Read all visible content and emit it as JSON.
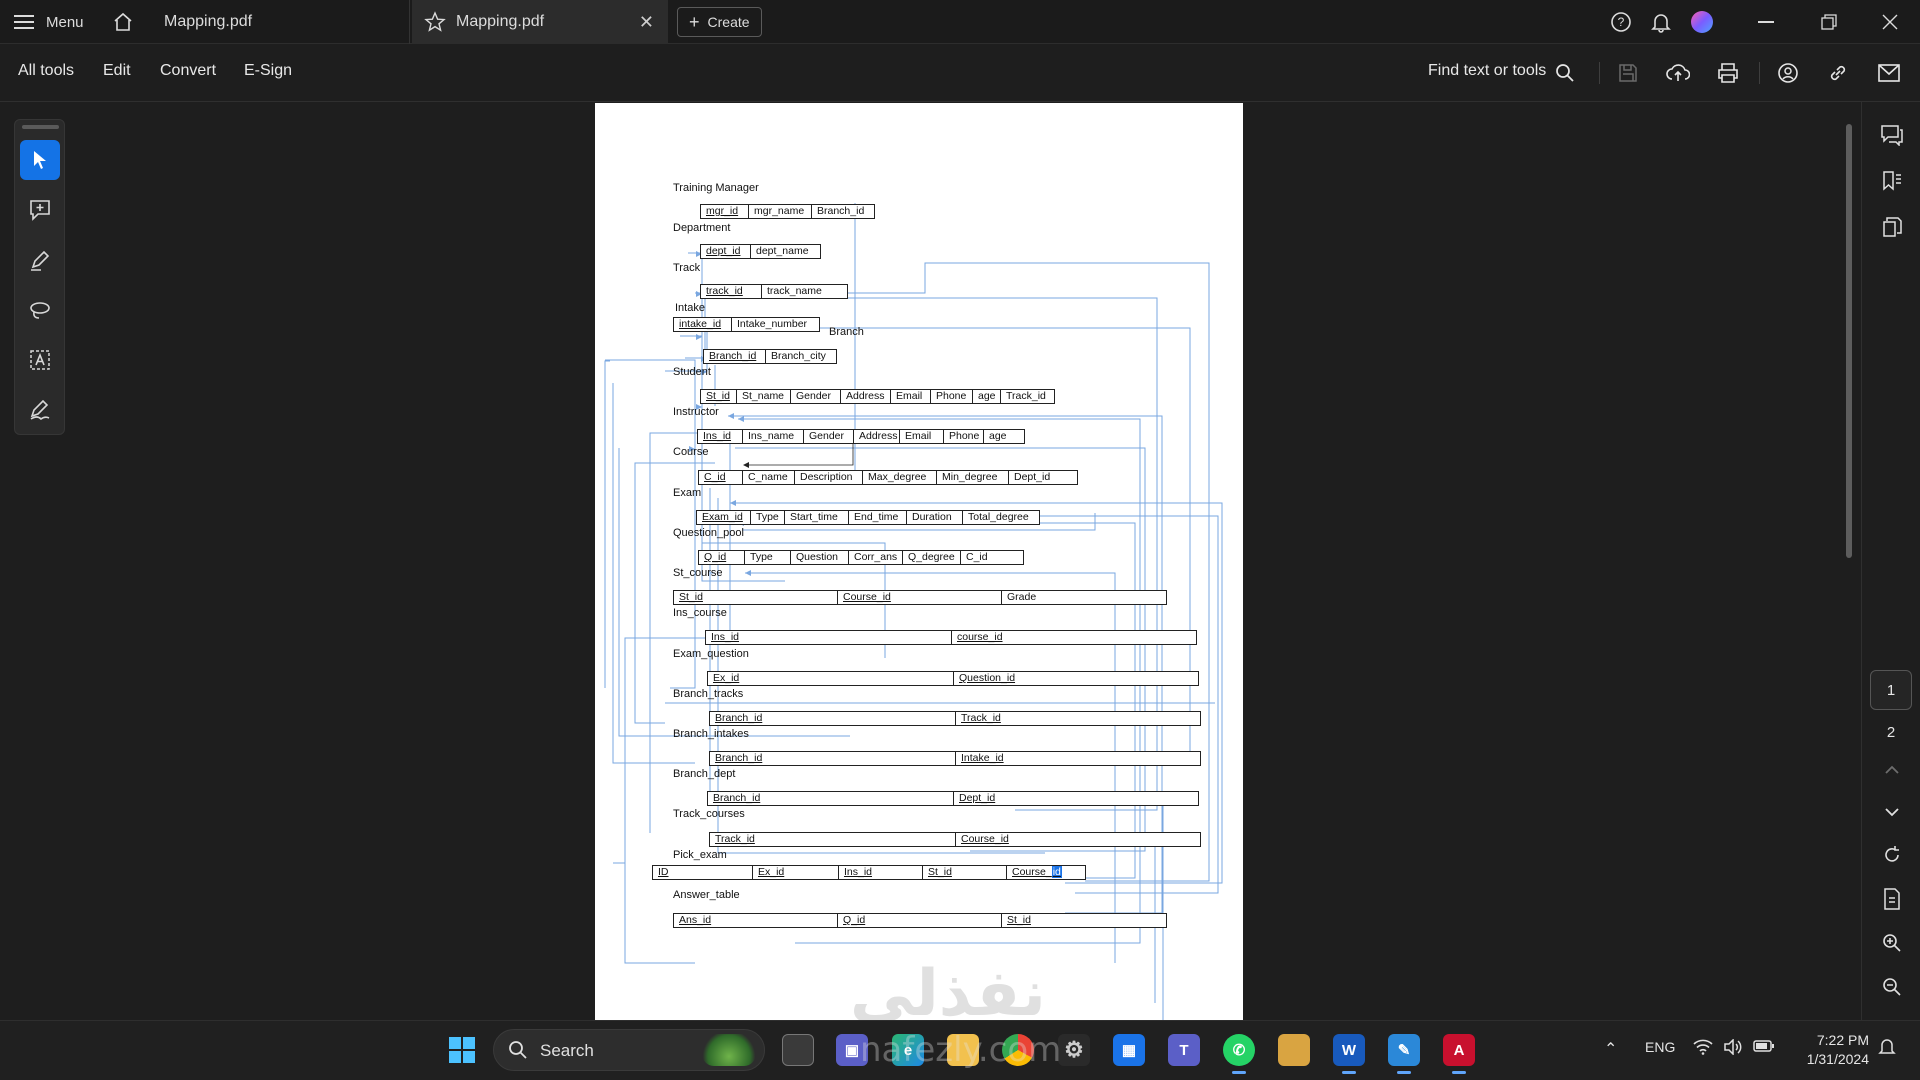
{
  "tabbar": {
    "menu_label": "Menu",
    "tabs": [
      {
        "label": "Mapping.pdf"
      },
      {
        "label": "Mapping.pdf"
      }
    ],
    "create_label": "Create"
  },
  "menubar": {
    "items": [
      "All tools",
      "Edit",
      "Convert",
      "E-Sign"
    ],
    "find_label": "Find text or tools"
  },
  "document": {
    "labels": {
      "training_manager": "Training Manager",
      "department": "Department",
      "track": "Track",
      "intake": "Intake",
      "branch": "Branch",
      "student": "Student",
      "instructor": "Instructor",
      "course": "Course",
      "exam": "Exam",
      "question_pool": "Question_pool",
      "st_course": "St_course",
      "ins_course": "Ins_course",
      "exam_question": "Exam_question",
      "branch_tracks": "Branch_tracks",
      "branch_intakes": "Branch_intakes",
      "branch_dept": "Branch_dept",
      "track_courses": "Track_courses",
      "pick_exam": "Pick_exam",
      "answer_table": "Answer_table"
    },
    "tables": {
      "manager": [
        "mgr_id",
        "mgr_name",
        "Branch_id"
      ],
      "department": [
        "dept_id",
        "dept_name"
      ],
      "track": [
        "track_id",
        "track_name"
      ],
      "intake": [
        "intake_id",
        "Intake_number"
      ],
      "branch": [
        "Branch_id",
        "Branch_city"
      ],
      "student": [
        "St_id",
        "St_name",
        "Gender",
        "Address",
        "Email",
        "Phone",
        "age",
        "Track_id"
      ],
      "instructor": [
        "Ins_id",
        "Ins_name",
        "Gender",
        "Address",
        "Email",
        "Phone",
        "age"
      ],
      "course": [
        "C_id",
        "C_name",
        "Description",
        "Max_degree",
        "Min_degree",
        "Dept_id"
      ],
      "exam": [
        "Exam_id",
        "Type",
        "Start_time",
        "End_time",
        "Duration",
        "Total_degree"
      ],
      "question_pool": [
        "Q_id",
        "Type",
        "Question",
        "Corr_ans",
        "Q_degree",
        "C_id"
      ],
      "st_course": [
        "St_id",
        "Course_id",
        "Grade"
      ],
      "ins_course": [
        "Ins_id",
        "course_id"
      ],
      "exam_question": [
        "Ex_id",
        "Question_id"
      ],
      "branch_tracks": [
        "Branch_id",
        "Track_id"
      ],
      "branch_intakes": [
        "Branch_id",
        "Intake_id"
      ],
      "branch_dept": [
        "Branch_id",
        "Dept_id"
      ],
      "track_courses": [
        "Track_id",
        "Course_id"
      ],
      "pick_exam": [
        "ID",
        "Ex_id",
        "Ins_id",
        "St_id",
        "Course_",
        "id"
      ],
      "answer_table": [
        "Ans_id",
        "Q_id",
        "St_id"
      ]
    },
    "watermark": "نفذلي"
  },
  "right_panel": {
    "pages": [
      "1",
      "2"
    ]
  },
  "taskbar": {
    "search_label": "Search",
    "lang": "ENG",
    "time": "7:22 PM",
    "date": "1/31/2024",
    "watermark": "nafezly.com"
  },
  "colors": {
    "accent": "#1473e6",
    "link_lines": "#7aa7e0",
    "page_bg": "#ffffff"
  }
}
